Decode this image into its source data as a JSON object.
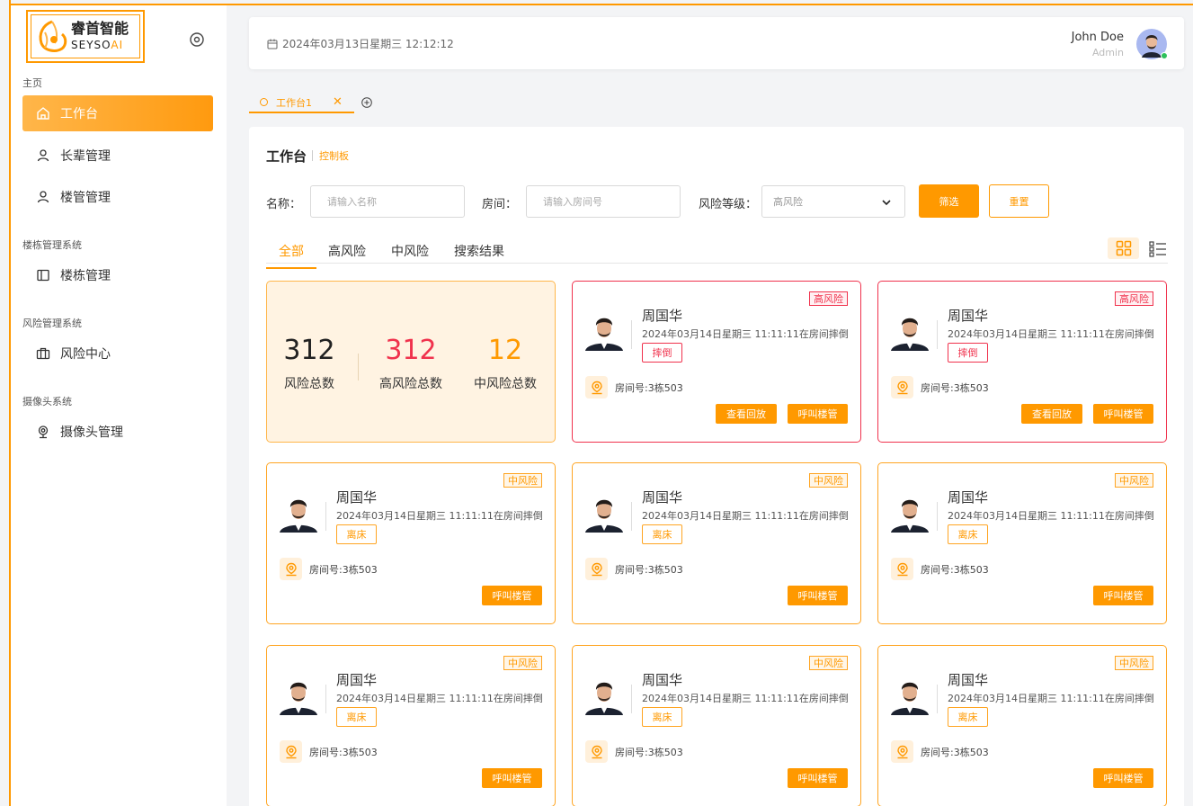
{
  "brand": {
    "name_cn": "睿首智能",
    "name_en_main": "SEYSO",
    "name_en_ai": "AI"
  },
  "sidebar": {
    "sections": [
      {
        "label": "主页"
      },
      {
        "label": "楼栋管理系统"
      },
      {
        "label": "风险管理系统"
      },
      {
        "label": "摄像头系统"
      }
    ],
    "items": [
      {
        "label": "工作台",
        "icon": "home-icon",
        "active": true
      },
      {
        "label": "长辈管理",
        "icon": "user-icon"
      },
      {
        "label": "楼管管理",
        "icon": "user-icon"
      },
      {
        "label": "楼栋管理",
        "icon": "sidebar-panel-icon"
      },
      {
        "label": "风险中心",
        "icon": "briefcase-icon"
      },
      {
        "label": "摄像头管理",
        "icon": "webcam-icon"
      }
    ]
  },
  "header": {
    "datetime": "2024年03月13日星期三 12:12:12",
    "user_name": "John Doe",
    "user_role": "Admin"
  },
  "page_tabs": [
    {
      "label": "工作台1"
    }
  ],
  "main": {
    "title": "工作台",
    "subtitle": "控制板",
    "filters": {
      "name_label": "名称：",
      "name_placeholder": "请输入名称",
      "room_label": "房间：",
      "room_placeholder": "请输入房间号",
      "risk_label": "风险等级：",
      "risk_value": "高风险",
      "filter_button": "筛选",
      "reset_button": "重置"
    },
    "tabs": [
      {
        "label": "全部",
        "active": true
      },
      {
        "label": "高风险"
      },
      {
        "label": "中风险"
      },
      {
        "label": "搜索结果"
      }
    ],
    "summary": {
      "total": {
        "value": "312",
        "label": "风险总数"
      },
      "high": {
        "value": "312",
        "label": "高风险总数"
      },
      "mid": {
        "value": "12",
        "label": "中风险总数"
      }
    },
    "cards": [
      {
        "level": "high",
        "badge": "高风险",
        "name": "周国华",
        "event": "2024年03月14日星期三 11:11:11在房间摔倒",
        "tag": "摔倒",
        "room": "房间号:3栋503",
        "replay": "查看回放",
        "call": "呼叫楼管"
      },
      {
        "level": "high",
        "badge": "高风险",
        "name": "周国华",
        "event": "2024年03月14日星期三 11:11:11在房间摔倒",
        "tag": "摔倒",
        "room": "房间号:3栋503",
        "replay": "查看回放",
        "call": "呼叫楼管"
      },
      {
        "level": "mid",
        "badge": "中风险",
        "name": "周国华",
        "event": "2024年03月14日星期三 11:11:11在房间摔倒",
        "tag": "离床",
        "room": "房间号:3栋503",
        "call": "呼叫楼管"
      },
      {
        "level": "mid",
        "badge": "中风险",
        "name": "周国华",
        "event": "2024年03月14日星期三 11:11:11在房间摔倒",
        "tag": "离床",
        "room": "房间号:3栋503",
        "call": "呼叫楼管"
      },
      {
        "level": "mid",
        "badge": "中风险",
        "name": "周国华",
        "event": "2024年03月14日星期三 11:11:11在房间摔倒",
        "tag": "离床",
        "room": "房间号:3栋503",
        "call": "呼叫楼管"
      },
      {
        "level": "mid",
        "badge": "中风险",
        "name": "周国华",
        "event": "2024年03月14日星期三 11:11:11在房间摔倒",
        "tag": "离床",
        "room": "房间号:3栋503",
        "call": "呼叫楼管"
      },
      {
        "level": "mid",
        "badge": "中风险",
        "name": "周国华",
        "event": "2024年03月14日星期三 11:11:11在房间摔倒",
        "tag": "离床",
        "room": "房间号:3栋503",
        "call": "呼叫楼管"
      },
      {
        "level": "mid",
        "badge": "中风险",
        "name": "周国华",
        "event": "2024年03月14日星期三 11:11:11在房间摔倒",
        "tag": "离床",
        "room": "房间号:3栋503",
        "call": "呼叫楼管"
      }
    ]
  },
  "colors": {
    "accent": "#ff9900",
    "high": "#f0324d",
    "mid": "#ff9900",
    "summary_bg": "#fff3e2"
  }
}
